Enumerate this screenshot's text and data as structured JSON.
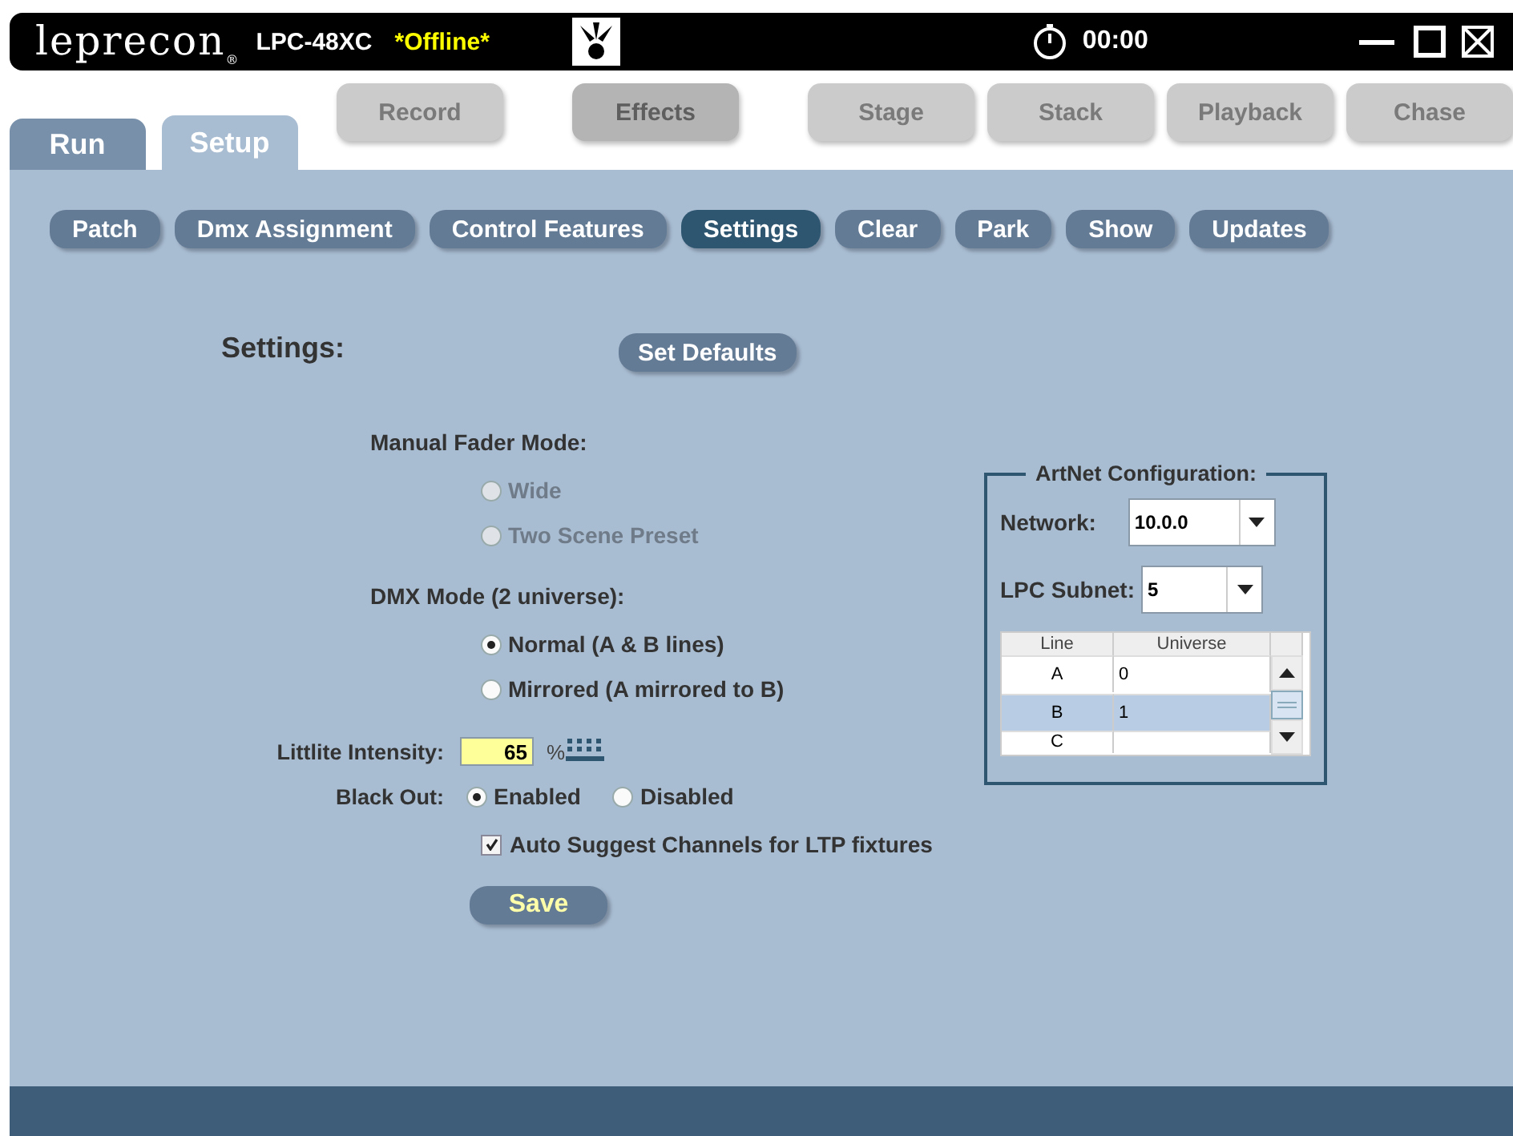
{
  "title_bar": {
    "logo": "leprecon$_{®}$",
    "model": "LPC-48XC",
    "status": "*Offline*",
    "timer": "00:00"
  },
  "main_tabs": [
    {
      "label": "Run",
      "selected": false
    },
    {
      "label": "Setup",
      "selected": true
    }
  ],
  "mode_buttons": [
    {
      "label": "Record",
      "selected": false
    },
    {
      "label": "Effects",
      "selected": true
    },
    {
      "label": "Stage",
      "selected": false
    },
    {
      "label": "Stack",
      "selected": false
    },
    {
      "label": "Playback",
      "selected": false
    },
    {
      "label": "Chase",
      "selected": false
    }
  ],
  "sub_tabs": [
    {
      "label": "Patch",
      "selected": false
    },
    {
      "label": "Dmx Assignment",
      "selected": false
    },
    {
      "label": "Control Features",
      "selected": false
    },
    {
      "label": "Settings",
      "selected": true
    },
    {
      "label": "Clear",
      "selected": false
    },
    {
      "label": "Park",
      "selected": false
    },
    {
      "label": "Show",
      "selected": false
    },
    {
      "label": "Updates",
      "selected": false
    }
  ],
  "settings": {
    "title": "Settings:",
    "defaults_button": "Set Defaults",
    "manual_fader_mode": {
      "label": "Manual Fader Mode:",
      "disabled": true,
      "options": [
        {
          "label": "Wide",
          "selected": false
        },
        {
          "label": "Two Scene Preset",
          "selected": false
        }
      ]
    },
    "dmx_mode": {
      "label": "DMX Mode (2 universe):",
      "options": [
        {
          "label": "Normal (A & B lines)",
          "selected": true
        },
        {
          "label": "Mirrored (A mirrored to B)",
          "selected": false
        }
      ]
    },
    "littlite": {
      "label": "Littlite Intensity:",
      "value": "65",
      "unit": "%"
    },
    "black_out": {
      "label": "Black Out:",
      "options": [
        {
          "label": "Enabled",
          "selected": true
        },
        {
          "label": "Disabled",
          "selected": false
        }
      ]
    },
    "auto_suggest": {
      "label": "Auto Suggest Channels for LTP fixtures",
      "checked": true
    },
    "save_button": "Save"
  },
  "artnet": {
    "title": "ArtNet Configuration:",
    "network": {
      "label": "Network:",
      "value": "10.0.0"
    },
    "subnet": {
      "label": "LPC Subnet:",
      "value": "5"
    },
    "table": {
      "columns": [
        "Line",
        "Universe"
      ],
      "rows": [
        {
          "line": "A",
          "universe": "0",
          "selected": false
        },
        {
          "line": "B",
          "universe": "1",
          "selected": true
        },
        {
          "line": "C",
          "universe": "",
          "selected": false
        }
      ]
    }
  }
}
